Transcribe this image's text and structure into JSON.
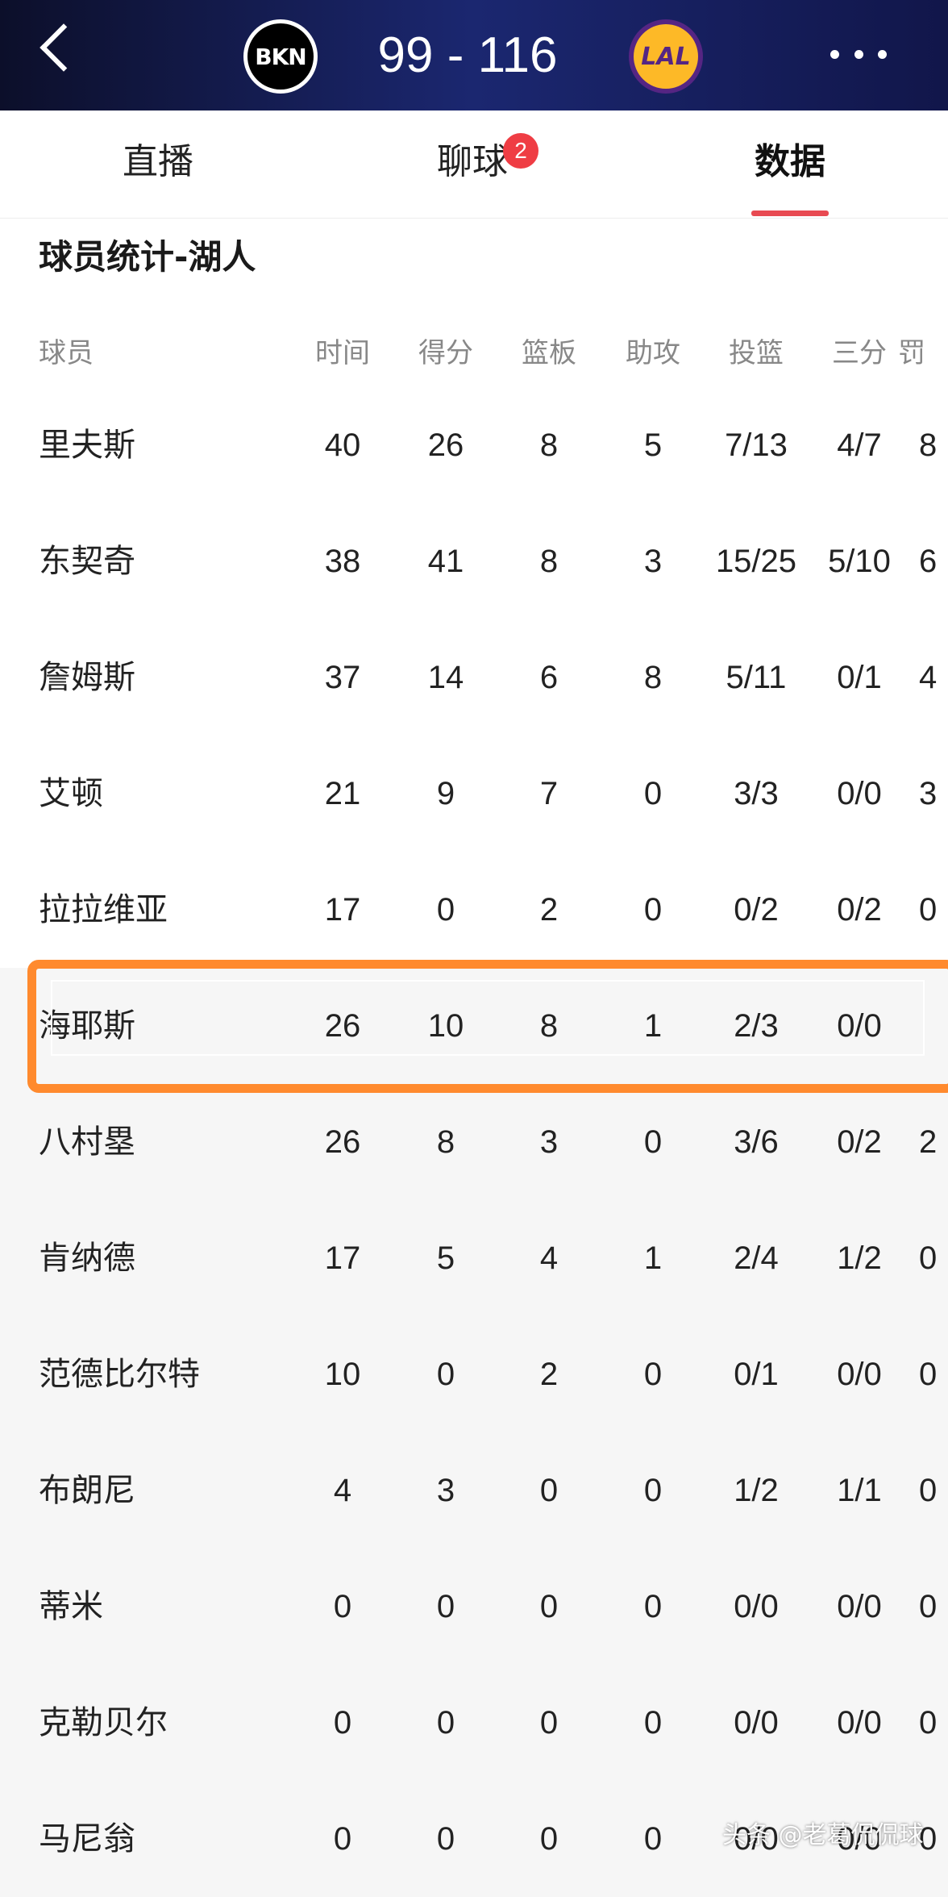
{
  "header": {
    "home_team": "BKN",
    "away_team": "LAL",
    "score": "99 - 116"
  },
  "tabs": [
    {
      "label": "直播"
    },
    {
      "label": "聊球",
      "badge": "2"
    },
    {
      "label": "数据"
    }
  ],
  "section_title": "球员统计-湖人",
  "columns": [
    "球员",
    "时间",
    "得分",
    "篮板",
    "助攻",
    "投篮",
    "三分",
    "罚"
  ],
  "players": [
    {
      "name": "里夫斯",
      "min": "40",
      "pts": "26",
      "reb": "8",
      "ast": "5",
      "fg": "7/13",
      "tp": "4/7",
      "ft": "8"
    },
    {
      "name": "东契奇",
      "min": "38",
      "pts": "41",
      "reb": "8",
      "ast": "3",
      "fg": "15/25",
      "tp": "5/10",
      "ft": "6"
    },
    {
      "name": "詹姆斯",
      "min": "37",
      "pts": "14",
      "reb": "6",
      "ast": "8",
      "fg": "5/11",
      "tp": "0/1",
      "ft": "4"
    },
    {
      "name": "艾顿",
      "min": "21",
      "pts": "9",
      "reb": "7",
      "ast": "0",
      "fg": "3/3",
      "tp": "0/0",
      "ft": "3"
    },
    {
      "name": "拉拉维亚",
      "min": "17",
      "pts": "0",
      "reb": "2",
      "ast": "0",
      "fg": "0/2",
      "tp": "0/2",
      "ft": "0"
    },
    {
      "name": "海耶斯",
      "min": "26",
      "pts": "10",
      "reb": "8",
      "ast": "1",
      "fg": "2/3",
      "tp": "0/0",
      "ft": ""
    },
    {
      "name": "八村塁",
      "min": "26",
      "pts": "8",
      "reb": "3",
      "ast": "0",
      "fg": "3/6",
      "tp": "0/2",
      "ft": "2"
    },
    {
      "name": "肯纳德",
      "min": "17",
      "pts": "5",
      "reb": "4",
      "ast": "1",
      "fg": "2/4",
      "tp": "1/2",
      "ft": "0"
    },
    {
      "name": "范德比尔特",
      "min": "10",
      "pts": "0",
      "reb": "2",
      "ast": "0",
      "fg": "0/1",
      "tp": "0/0",
      "ft": "0"
    },
    {
      "name": "布朗尼",
      "min": "4",
      "pts": "3",
      "reb": "0",
      "ast": "0",
      "fg": "1/2",
      "tp": "1/1",
      "ft": "0"
    },
    {
      "name": "蒂米",
      "min": "0",
      "pts": "0",
      "reb": "0",
      "ast": "0",
      "fg": "0/0",
      "tp": "0/0",
      "ft": "0"
    },
    {
      "name": "克勒贝尔",
      "min": "0",
      "pts": "0",
      "reb": "0",
      "ast": "0",
      "fg": "0/0",
      "tp": "0/0",
      "ft": "0"
    },
    {
      "name": "马尼翁",
      "min": "0",
      "pts": "0",
      "reb": "0",
      "ast": "0",
      "fg": "0/0",
      "tp": "0/0",
      "ft": "0"
    }
  ],
  "watermark": "头条 @老葛侃侃球",
  "colors": {
    "tab_accent": "#e84a52",
    "highlight": "#ff8a2e",
    "badge": "#ef3d44"
  }
}
